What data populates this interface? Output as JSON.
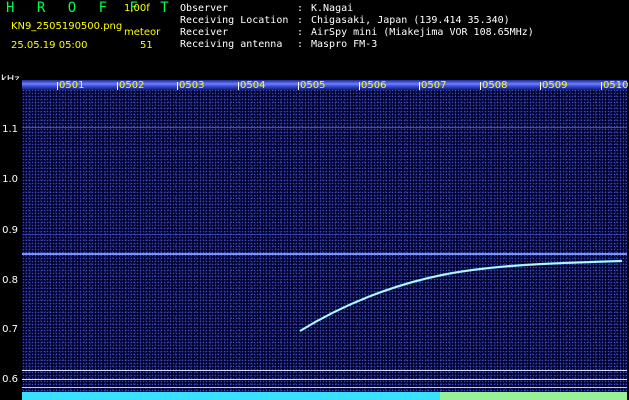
{
  "header": {
    "logo": "H R O F F T",
    "version": "1.00f",
    "filename": "KN9_2505190500.png",
    "mode": "meteor",
    "datetime": "25.05.19 05:00",
    "count": "51",
    "info": [
      {
        "label": "Observer",
        "sep": ":",
        "value": "K.Nagai"
      },
      {
        "label": "Receiving Location",
        "sep": ":",
        "value": "Chigasaki, Japan (139.414 35.340)"
      },
      {
        "label": "Receiver",
        "sep": ":",
        "value": "AirSpy mini (Miakejima VOR 108.65MHz)"
      },
      {
        "label": "Receiving antenna",
        "sep": ":",
        "value": "Maspro FM-3"
      }
    ]
  },
  "axis": {
    "unit": "kHz",
    "y_labels": [
      "1.1",
      "1.0",
      "0.9",
      "0.8",
      "0.7",
      "0.6"
    ],
    "time_labels": [
      "0501",
      "0502",
      "0503",
      "0504",
      "0505",
      "0506",
      "0507",
      "0508",
      "0509",
      "0510"
    ]
  },
  "colors": {
    "background": "#00002e",
    "text_yellow": "#ffff00",
    "logo_green": "#00ff4c",
    "trail": "#8ef0ff",
    "bottom_band": "#39e0ff"
  }
}
